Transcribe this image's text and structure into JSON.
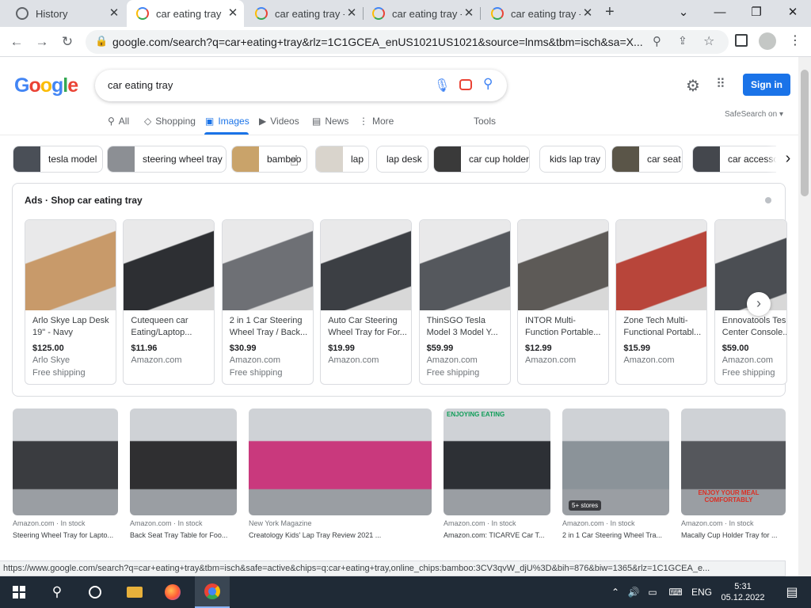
{
  "browser": {
    "tabs": [
      {
        "title": "History",
        "active": false
      },
      {
        "title": "car eating tray",
        "active": true
      },
      {
        "title": "car eating tray -",
        "active": false
      },
      {
        "title": "car eating tray -",
        "active": false
      },
      {
        "title": "car eating tray -",
        "active": false
      }
    ],
    "url": "google.com/search?q=car+eating+tray&rlz=1C1GCEA_enUS1021US1021&source=lnms&tbm=isch&sa=X..."
  },
  "google": {
    "logo": "Google",
    "query": "car eating tray",
    "signin": "Sign in",
    "safesearch": "SafeSearch on",
    "nav": [
      {
        "label": "All",
        "icon": "search-icon"
      },
      {
        "label": "Shopping",
        "icon": "tag-icon"
      },
      {
        "label": "Images",
        "icon": "image-icon",
        "active": true
      },
      {
        "label": "Videos",
        "icon": "video-icon"
      },
      {
        "label": "News",
        "icon": "news-icon"
      },
      {
        "label": "More",
        "icon": "more-icon"
      }
    ],
    "tools": "Tools"
  },
  "chips": [
    {
      "label": "tesla model",
      "color": "#4a4f57"
    },
    {
      "label": "steering wheel tray",
      "color": "#8c8f94"
    },
    {
      "label": "bamboo",
      "color": "#c9a36a"
    },
    {
      "label": "lap",
      "color": "#d9d4cc"
    },
    {
      "label": "lap desk",
      "color": null
    },
    {
      "label": "car cup holder",
      "color": "#3a3a3a"
    },
    {
      "label": "kids lap tray",
      "color": null
    },
    {
      "label": "car seat",
      "color": "#5a5548"
    },
    {
      "label": "car accessories",
      "color": "#44474d"
    }
  ],
  "ads": {
    "label": "Ads",
    "title": "Shop car eating tray",
    "products": [
      {
        "title": "Arlo Skye Lap Desk 19\" - Navy",
        "price": "$125.00",
        "seller": "Arlo Skye",
        "shipping": "Free shipping",
        "color": "#c89a6a"
      },
      {
        "title": "Cutequeen car Eating/Laptop...",
        "price": "$11.96",
        "seller": "Amazon.com",
        "shipping": "",
        "color": "#2d2f33"
      },
      {
        "title": "2 in 1 Car Steering Wheel Tray / Back...",
        "price": "$30.99",
        "seller": "Amazon.com",
        "shipping": "Free shipping",
        "color": "#6e7075"
      },
      {
        "title": "Auto Car Steering Wheel Tray for For...",
        "price": "$19.99",
        "seller": "Amazon.com",
        "shipping": "",
        "color": "#3c3f44"
      },
      {
        "title": "ThinSGO Tesla Model 3 Model Y...",
        "price": "$59.99",
        "seller": "Amazon.com",
        "shipping": "Free shipping",
        "color": "#55585d"
      },
      {
        "title": "INTOR Multi-Function Portable...",
        "price": "$12.99",
        "seller": "Amazon.com",
        "shipping": "",
        "color": "#5d5a57"
      },
      {
        "title": "Zone Tech Multi-Functional Portabl...",
        "price": "$15.99",
        "seller": "Amazon.com",
        "shipping": "",
        "color": "#b8453a"
      },
      {
        "title": "Ennovatools Tesla Center Console...",
        "price": "$59.00",
        "seller": "Amazon.com",
        "shipping": "Free shipping",
        "color": "#4b4e53"
      }
    ]
  },
  "results": [
    {
      "source": "Amazon.com · In stock",
      "title": "Steering Wheel Tray for Lapto...",
      "badge": "",
      "color": "#3a3c40"
    },
    {
      "source": "Amazon.com · In stock",
      "title": "Back Seat Tray Table for Foo...",
      "badge": "",
      "color": "#2f2f31"
    },
    {
      "source": "New York Magazine",
      "title": "Creatology Kids' Lap Tray Review 2021 ...",
      "badge": "",
      "color": "#c9397d"
    },
    {
      "source": "Amazon.com · In stock",
      "title": "Amazon.com: TICARVE Car T...",
      "badge": "",
      "color": "#2d3035"
    },
    {
      "source": "Amazon.com · In stock",
      "title": "2 in 1 Car Steering Wheel Tra...",
      "badge": "5+ stores",
      "color": "#8b9399"
    },
    {
      "source": "Amazon.com · In stock",
      "title": "Macally Cup Holder Tray for ...",
      "badge": "",
      "color": "#55575c"
    }
  ],
  "banner_text": "ENJOY YOUR MEAL COMFORTABLY",
  "result_overlay_text": "ENJOYING EATING",
  "status_url": "https://www.google.com/search?q=car+eating+tray&tbm=isch&safe=active&chips=q:car+eating+tray,online_chips:bamboo:3CV3qvW_djU%3D&bih=876&biw=1365&rlz=1C1GCEA_e...",
  "taskbar": {
    "language": "ENG",
    "time": "5:31",
    "date": "05.12.2022"
  }
}
